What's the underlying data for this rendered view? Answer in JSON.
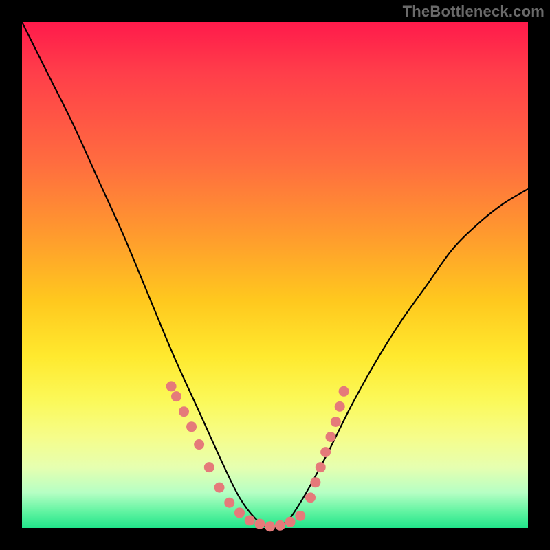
{
  "watermark": "TheBottleneck.com",
  "chart_data": {
    "type": "line",
    "title": "",
    "xlabel": "",
    "ylabel": "",
    "xlim": [
      0,
      100
    ],
    "ylim": [
      0,
      100
    ],
    "grid": false,
    "legend": false,
    "series": [
      {
        "name": "bottleneck-curve",
        "x": [
          0,
          5,
          10,
          15,
          20,
          25,
          30,
          35,
          40,
          43,
          46,
          49,
          52,
          55,
          60,
          65,
          70,
          75,
          80,
          85,
          90,
          95,
          100
        ],
        "values": [
          100,
          90,
          80,
          69,
          58,
          46,
          34,
          23,
          12,
          6,
          2,
          0,
          1,
          5,
          14,
          24,
          33,
          41,
          48,
          55,
          60,
          64,
          67
        ]
      }
    ],
    "points_left": [
      {
        "x": 29.5,
        "y": 28
      },
      {
        "x": 30.5,
        "y": 26
      },
      {
        "x": 32,
        "y": 23
      },
      {
        "x": 33.5,
        "y": 20
      },
      {
        "x": 35,
        "y": 16.5
      },
      {
        "x": 37,
        "y": 12
      },
      {
        "x": 39,
        "y": 8
      },
      {
        "x": 41,
        "y": 5
      },
      {
        "x": 43,
        "y": 3
      }
    ],
    "points_bottom": [
      {
        "x": 45,
        "y": 1.5
      },
      {
        "x": 47,
        "y": 0.8
      },
      {
        "x": 49,
        "y": 0.3
      },
      {
        "x": 51,
        "y": 0.5
      },
      {
        "x": 53,
        "y": 1.2
      },
      {
        "x": 55,
        "y": 2.4
      }
    ],
    "points_right": [
      {
        "x": 57,
        "y": 6
      },
      {
        "x": 58,
        "y": 9
      },
      {
        "x": 59,
        "y": 12
      },
      {
        "x": 60,
        "y": 15
      },
      {
        "x": 61,
        "y": 18
      },
      {
        "x": 62,
        "y": 21
      },
      {
        "x": 62.8,
        "y": 24
      },
      {
        "x": 63.6,
        "y": 27
      }
    ]
  }
}
